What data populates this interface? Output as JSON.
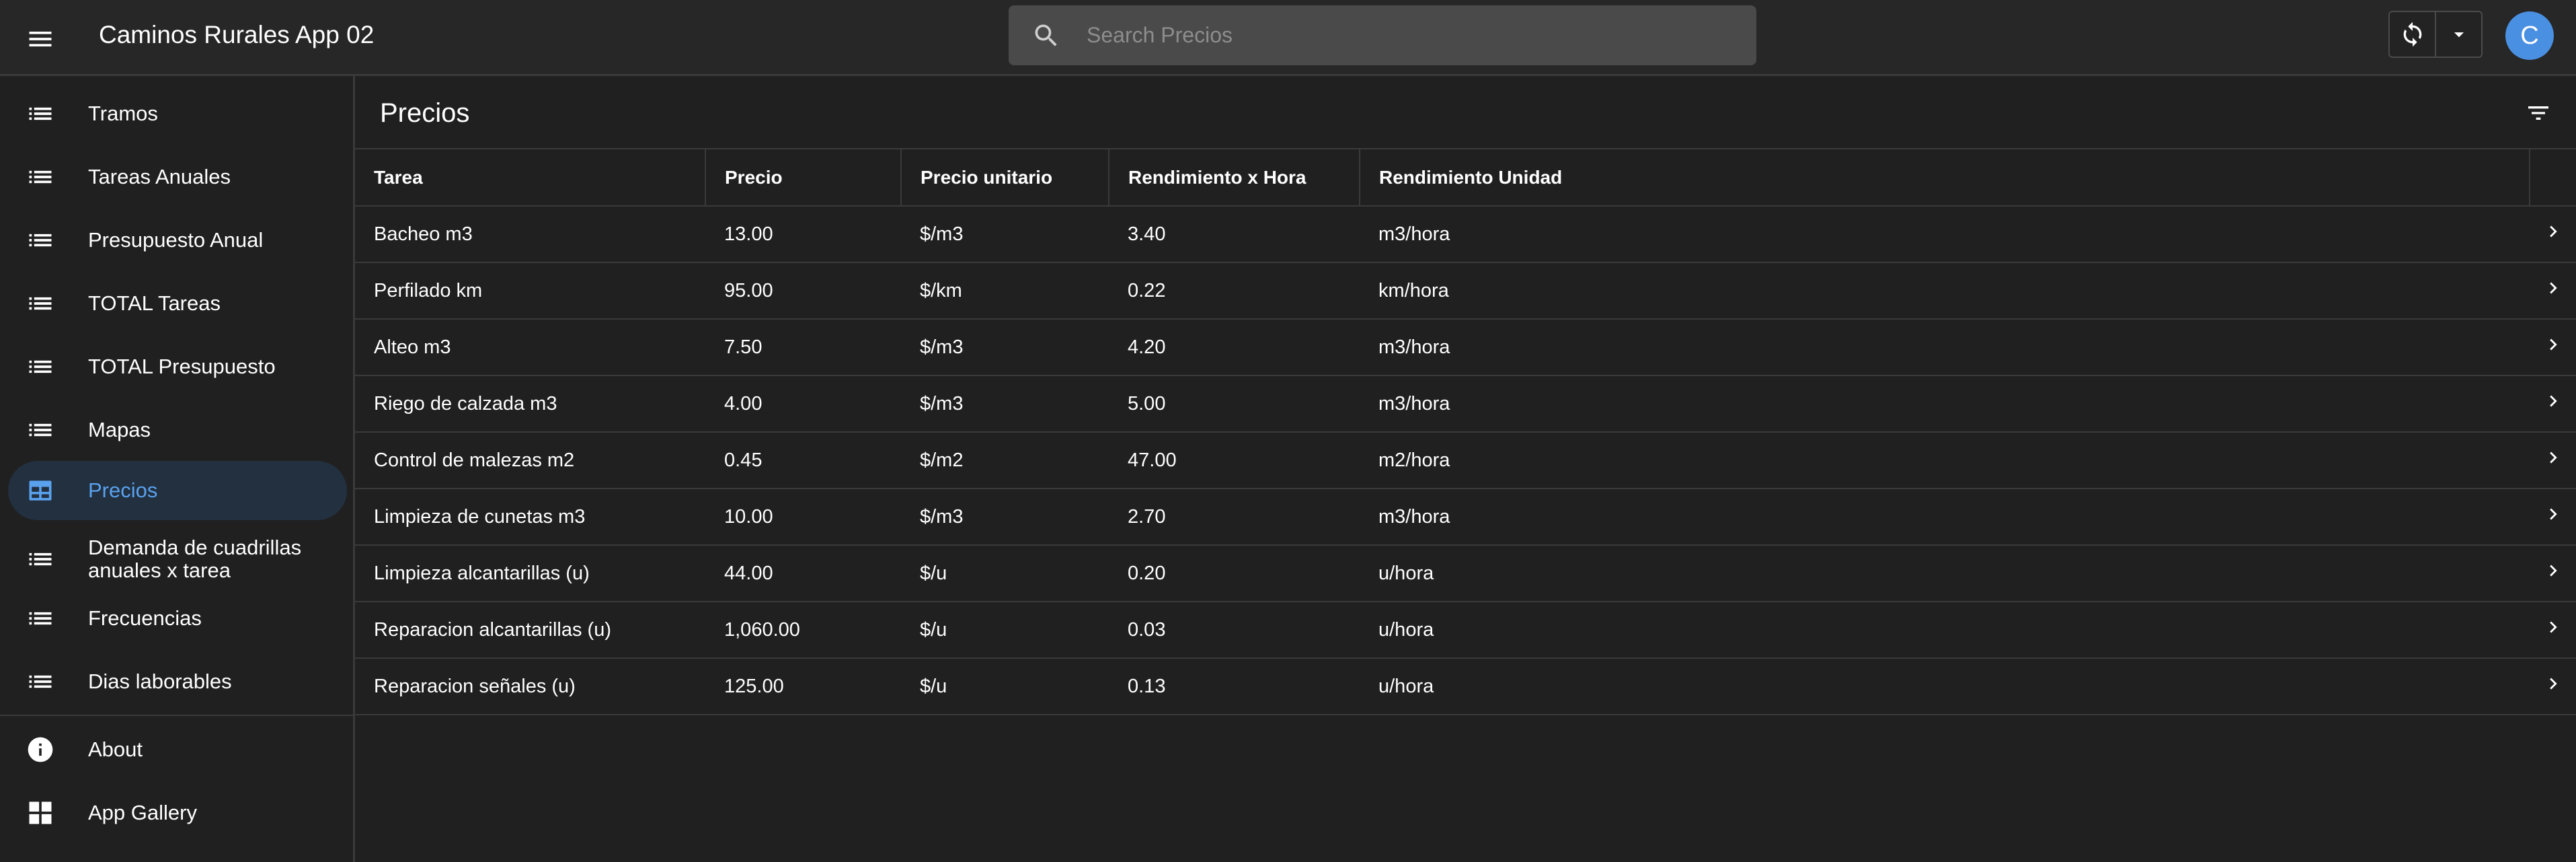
{
  "app": {
    "title": "Caminos Rurales App 02",
    "avatar_initial": "C",
    "accent_color": "#5aa2ee"
  },
  "search": {
    "placeholder": "Search Precios",
    "value": ""
  },
  "icons": {
    "menu": "menu-icon",
    "search": "search-icon",
    "sync": "sync-icon",
    "dropdown": "caret-down-icon",
    "filter": "filter-icon",
    "list": "list-icon",
    "table": "table-icon",
    "info": "info-icon",
    "gallery": "app-gallery-icon",
    "chevron": "chevron-right-icon"
  },
  "sidebar": {
    "items": [
      {
        "label": "Tramos",
        "icon": "list-icon"
      },
      {
        "label": "Tareas Anuales",
        "icon": "list-icon"
      },
      {
        "label": "Presupuesto Anual",
        "icon": "list-icon"
      },
      {
        "label": "TOTAL Tareas",
        "icon": "list-icon"
      },
      {
        "label": "TOTAL Presupuesto",
        "icon": "list-icon"
      },
      {
        "label": "Mapas",
        "icon": "list-icon"
      },
      {
        "label": "Precios",
        "icon": "table-icon",
        "active": true
      },
      {
        "label": "Demanda de cuadrillas anuales x tarea",
        "icon": "list-icon"
      },
      {
        "label": "Frecuencias",
        "icon": "list-icon"
      },
      {
        "label": "Dias laborables",
        "icon": "list-icon"
      }
    ],
    "footer": [
      {
        "label": "About",
        "icon": "info-icon"
      },
      {
        "label": "App Gallery",
        "icon": "app-gallery-icon"
      }
    ]
  },
  "page": {
    "title": "Precios"
  },
  "table": {
    "columns": [
      "Tarea",
      "Precio",
      "Precio unitario",
      "Rendimiento x Hora",
      "Rendimiento Unidad"
    ],
    "rows": [
      [
        "Bacheo m3",
        "13.00",
        "$/m3",
        "3.40",
        "m3/hora"
      ],
      [
        "Perfilado km",
        "95.00",
        "$/km",
        "0.22",
        "km/hora"
      ],
      [
        "Alteo m3",
        "7.50",
        "$/m3",
        "4.20",
        "m3/hora"
      ],
      [
        "Riego de calzada m3",
        "4.00",
        "$/m3",
        "5.00",
        "m3/hora"
      ],
      [
        "Control de malezas m2",
        "0.45",
        "$/m2",
        "47.00",
        "m2/hora"
      ],
      [
        "Limpieza de cunetas m3",
        "10.00",
        "$/m3",
        "2.70",
        "m3/hora"
      ],
      [
        "Limpieza alcantarillas (u)",
        "44.00",
        "$/u",
        "0.20",
        "u/hora"
      ],
      [
        "Reparacion alcantarillas (u)",
        "1,060.00",
        "$/u",
        "0.03",
        "u/hora"
      ],
      [
        "Reparacion señales (u)",
        "125.00",
        "$/u",
        "0.13",
        "u/hora"
      ]
    ]
  }
}
